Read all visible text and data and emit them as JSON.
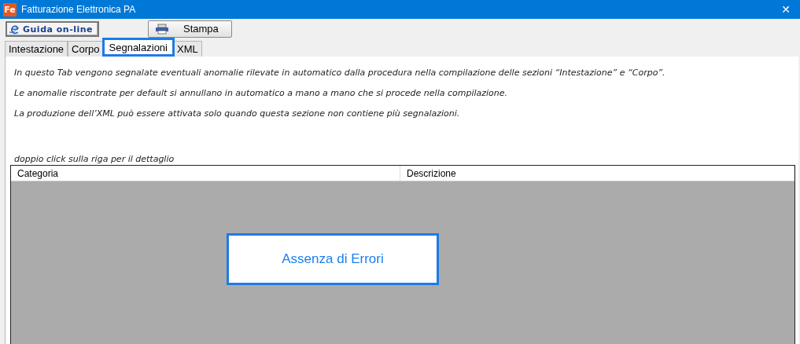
{
  "window": {
    "title": "Fatturazione Elettronica PA",
    "logo": "Fe",
    "close": "✕"
  },
  "toolbar": {
    "buttons": [
      {
        "kind": "help",
        "label": "Guida on-line"
      },
      {
        "kind": "print",
        "label": "Stampa"
      }
    ]
  },
  "tabs": [
    {
      "label": "Intestazione",
      "selected": false
    },
    {
      "label": "Corpo",
      "selected": false
    },
    {
      "label": "Segnalazioni",
      "selected": true
    },
    {
      "label": "XML",
      "selected": false
    }
  ],
  "notes": [
    "In questo Tab vengono segnalate eventuali anomalie rilevate in automatico dalla procedura nella compilazione delle sezioni “Intestazione” e “Corpo”.",
    "Le anomalie riscontrate per default si annullano in automatico a mano a mano che si procede nella compilazione.",
    "La produzione dell’XML può essere attivata solo quando questa sezione non contiene più segnalazioni."
  ],
  "table": {
    "hint": "doppio click sulla riga per il dettaglio",
    "columns": [
      "Categoria",
      "Descrizione"
    ],
    "message": "Assenza di Errori"
  }
}
